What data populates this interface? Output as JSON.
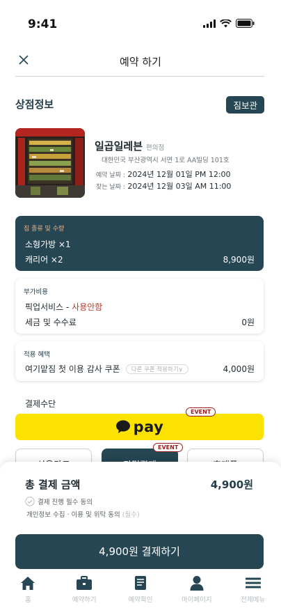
{
  "status_bar": {
    "time": "9:41"
  },
  "header": {
    "title": "예약 하기"
  },
  "store_section": {
    "title": "상점정보",
    "badge": "짐보관"
  },
  "store": {
    "name": "일곱일레븐",
    "category": "편의점",
    "address": "대한민국 부산광역시 서면 1로 AA빌딩 101호",
    "reserve_label": "예약 날짜 :",
    "reserve_date": "2024년 12월 01일 PM 12:00",
    "pickup_label": "찾는 날짜 :",
    "pickup_date": "2024년 12월 03일 AM 11:00"
  },
  "luggage_card": {
    "label": "짐 종류 및 수량",
    "item1": "소형가방 ×1",
    "item2": "캐리어 ×2",
    "price": "8,900원"
  },
  "extra_card": {
    "label": "부가비용",
    "pickup_service": "픽업서비스 - ",
    "pickup_status": "사용안함",
    "tax_label": "세금 및 수수료",
    "tax_value": "0원"
  },
  "benefit_card": {
    "label": "적용 혜택",
    "coupon": "여기맡짐 첫 이용 감사 쿠폰",
    "other_coupon": "다른 쿠폰 적용하기∨",
    "discount": "4,000원"
  },
  "payment": {
    "title": "결제수단",
    "kakao_text": "pay",
    "event_label": "EVENT",
    "tabs": [
      "신용카드",
      "간편결제",
      "휴대폰"
    ]
  },
  "summary": {
    "total_label": "총 결제 금액",
    "total_amount": "4,900원",
    "agree_text": "결제 진행 필수 동의",
    "privacy_text": "개인정보 수집 · 이용 및 위탁 동의 ",
    "required": "(필수)",
    "cta": "4,900원 결제하기"
  },
  "nav": {
    "items": [
      {
        "label": "홈",
        "icon": "home-icon"
      },
      {
        "label": "예약하기",
        "icon": "briefcase-icon"
      },
      {
        "label": "예약확인",
        "icon": "document-icon"
      },
      {
        "label": "마이페이지",
        "icon": "person-icon"
      },
      {
        "label": "전체메뉴",
        "icon": "menu-icon"
      }
    ]
  },
  "colors": {
    "primary": "#264653",
    "kakao": "#fbe200",
    "event": "#9b1c1c",
    "accent_label": "#e9b38a"
  }
}
